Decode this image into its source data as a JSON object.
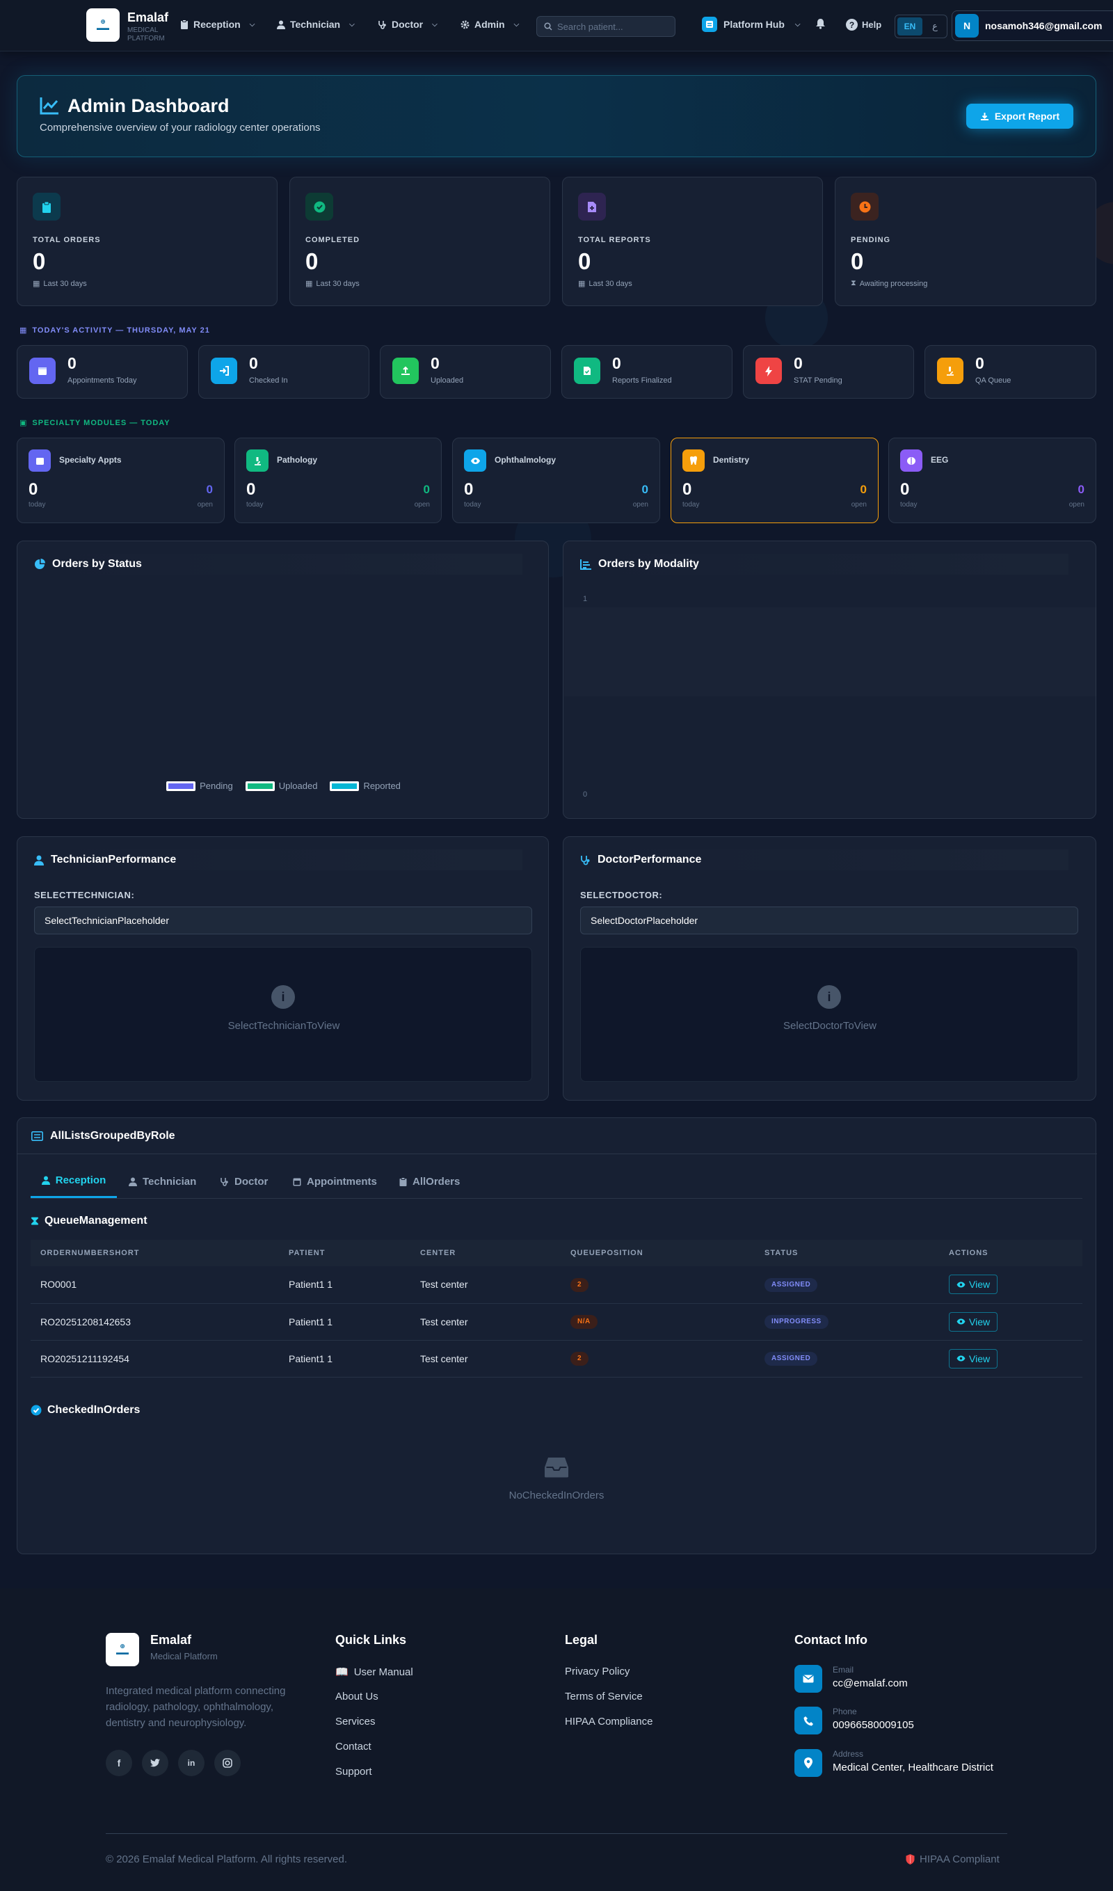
{
  "nav": {
    "brand_name": "Emalaf",
    "brand_sub": "MEDICAL PLATFORM",
    "menu": [
      {
        "label": "Reception"
      },
      {
        "label": "Technician"
      },
      {
        "label": "Doctor"
      },
      {
        "label": "Admin"
      }
    ],
    "search_placeholder": "Search patient...",
    "platform_hub": "Platform Hub",
    "help": "Help",
    "lang_en": "EN",
    "lang_ar": "ع",
    "avatar_letter": "N",
    "user_email": "nosamoh346@gmail.com"
  },
  "hero": {
    "title": "Admin Dashboard",
    "subtitle": "Comprehensive overview of your radiology center operations",
    "export_label": "Export Report"
  },
  "stats": [
    {
      "label": "TOTAL ORDERS",
      "value": "0",
      "footer": "Last 30 days"
    },
    {
      "label": "COMPLETED",
      "value": "0",
      "footer": "Last 30 days"
    },
    {
      "label": "TOTAL REPORTS",
      "value": "0",
      "footer": "Last 30 days"
    },
    {
      "label": "PENDING",
      "value": "0",
      "footer": "Awaiting processing"
    }
  ],
  "activity": {
    "heading": "TODAY'S ACTIVITY — THURSDAY, MAY 21",
    "items": [
      {
        "value": "0",
        "label": "Appointments Today"
      },
      {
        "value": "0",
        "label": "Checked In"
      },
      {
        "value": "0",
        "label": "Uploaded"
      },
      {
        "value": "0",
        "label": "Reports Finalized"
      },
      {
        "value": "0",
        "label": "STAT Pending"
      },
      {
        "value": "0",
        "label": "QA Queue"
      }
    ]
  },
  "specialty": {
    "heading": "SPECIALTY MODULES — TODAY",
    "items": [
      {
        "title": "Specialty Appts",
        "value": "0",
        "today": "today",
        "open_value": "0",
        "open": "open"
      },
      {
        "title": "Pathology",
        "value": "0",
        "today": "today",
        "open_value": "0",
        "open": "open"
      },
      {
        "title": "Ophthalmology",
        "value": "0",
        "today": "today",
        "open_value": "0",
        "open": "open"
      },
      {
        "title": "Dentistry",
        "value": "0",
        "today": "today",
        "open_value": "0",
        "open": "open"
      },
      {
        "title": "EEG",
        "value": "0",
        "today": "today",
        "open_value": "0",
        "open": "open"
      }
    ]
  },
  "charts": {
    "status_title": "Orders by Status",
    "modality_title": "Orders by Modality",
    "legend": [
      "Pending",
      "Uploaded",
      "Reported"
    ],
    "legend_colors": [
      "#6366f1",
      "#10b981",
      "#06b6d4"
    ]
  },
  "chart_data": [
    {
      "type": "pie",
      "title": "Orders by Status",
      "categories": [
        "Pending",
        "Uploaded",
        "Reported"
      ],
      "values": [
        0,
        0,
        0
      ]
    },
    {
      "type": "bar",
      "title": "Orders by Modality",
      "categories": [],
      "values": [],
      "ylim": [
        0,
        1
      ],
      "yticks": [
        "1",
        "0"
      ]
    }
  ],
  "performance": {
    "tech_title": "TechnicianPerformance",
    "tech_label": "SELECTTECHNICIAN:",
    "tech_select": "SelectTechnicianPlaceholder",
    "tech_empty": "SelectTechnicianToView",
    "doc_title": "DoctorPerformance",
    "doc_label": "SELECTDOCTOR:",
    "doc_select": "SelectDoctorPlaceholder",
    "doc_empty": "SelectDoctorToView"
  },
  "lists": {
    "title": "AllListsGroupedByRole",
    "tabs": [
      "Reception",
      "Technician",
      "Doctor",
      "Appointments",
      "AllOrders"
    ],
    "queue_title": "QueueManagement",
    "columns": [
      "ORDERNUMBERSHORT",
      "PATIENT",
      "CENTER",
      "QUEUEPOSITION",
      "STATUS",
      "ACTIONS"
    ],
    "rows": [
      {
        "order": "RO0001",
        "patient": "Patient1 1",
        "center": "Test center",
        "queue": "2",
        "status": "ASSIGNED",
        "action": "View"
      },
      {
        "order": "RO20251208142653",
        "patient": "Patient1 1",
        "center": "Test center",
        "queue": "N/A",
        "status": "INPROGRESS",
        "action": "View"
      },
      {
        "order": "RO20251211192454",
        "patient": "Patient1 1",
        "center": "Test center",
        "queue": "2",
        "status": "ASSIGNED",
        "action": "View"
      }
    ],
    "checked_title": "CheckedInOrders",
    "checked_empty": "NoCheckedInOrders"
  },
  "footer": {
    "brand": "Emalaf",
    "brand_sub": "Medical Platform",
    "desc_lines": [
      "Integrated medical platform connecting",
      "radiology, pathology, ophthalmology,",
      "dentistry and neurophysiology."
    ],
    "quick_title": "Quick Links",
    "quick": [
      "User Manual",
      "About Us",
      "Services",
      "Contact",
      "Support"
    ],
    "legal_title": "Legal",
    "legal": [
      "Privacy Policy",
      "Terms of Service",
      "HIPAA Compliance"
    ],
    "contact_title": "Contact Info",
    "email_label": "Email",
    "email": "cc@emalaf.com",
    "phone_label": "Phone",
    "phone": "00966580009105",
    "address_label": "Address",
    "address": "Medical Center, Healthcare District",
    "copyright": "© 2026 Emalaf Medical Platform. All rights reserved.",
    "hipaa": "HIPAA Compliant"
  }
}
